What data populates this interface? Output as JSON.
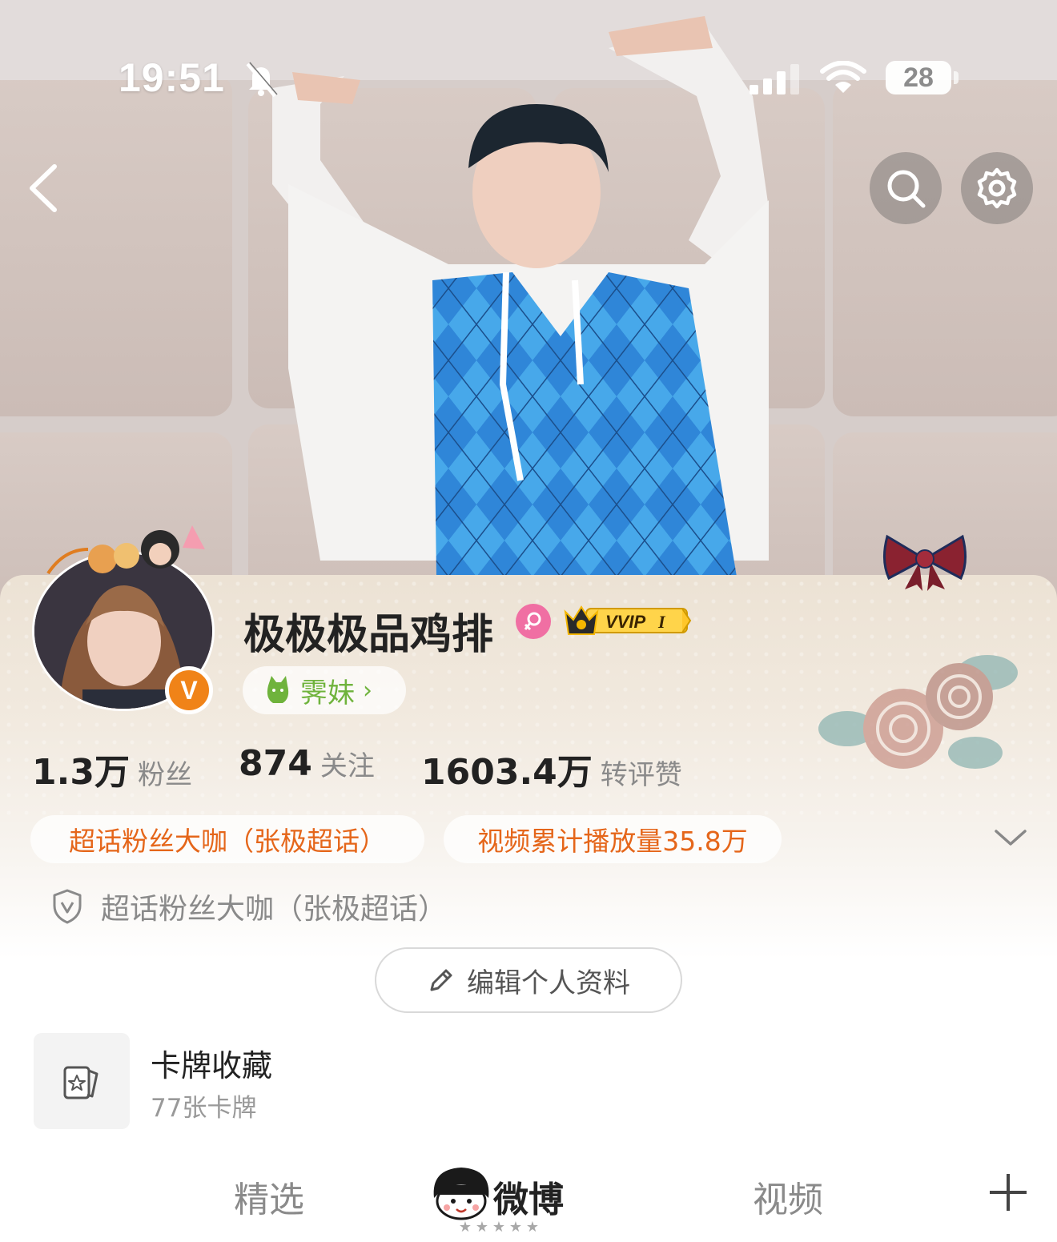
{
  "status_bar": {
    "time": "19:51",
    "battery": "28",
    "icons": [
      "bell-muted-icon",
      "signal-icon",
      "wifi-icon",
      "battery-icon"
    ]
  },
  "nav": {
    "icons": [
      "back-icon",
      "search-icon",
      "settings-icon"
    ]
  },
  "profile": {
    "name": "极极极品鸡排",
    "gender_icon": "female-icon",
    "vip_label": "VVIP",
    "vip_level": "I",
    "verified_badge": "V",
    "fan_tag_label": "霁妹",
    "fan_tag_chevron": "›"
  },
  "stats": [
    {
      "value": "1.3万",
      "label": "粉丝"
    },
    {
      "value": "874",
      "label": "关注"
    },
    {
      "value": "1603.4万",
      "label": "转评赞"
    }
  ],
  "tags": [
    "超话粉丝大咖（张极超话）",
    "视频累计播放量35.8万"
  ],
  "certification": "超话粉丝大咖（张极超话）",
  "edit_profile_label": "编辑个人资料",
  "card_collection": {
    "title": "卡牌收藏",
    "subtitle": "77张卡牌"
  },
  "tabs": [
    {
      "label": "精选"
    },
    {
      "label": "微博"
    },
    {
      "label": "视频"
    }
  ],
  "colors": {
    "accent_orange": "#e5661a",
    "fan_green": "#6fb33c",
    "gender_pink": "#f06fa3",
    "vip_gold": "#f5b700"
  }
}
